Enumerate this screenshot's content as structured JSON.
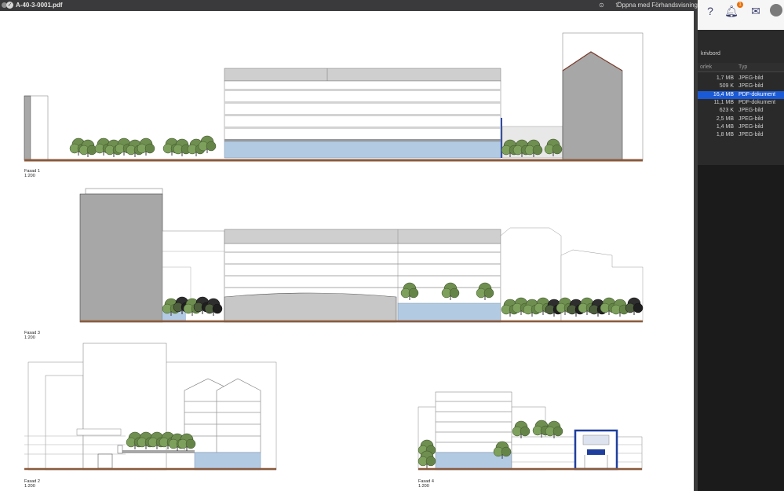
{
  "window": {
    "filename": "A-40-3-0001.pdf",
    "open_with": "Öppna med Förhandsvisning"
  },
  "notifications": {
    "badge_count": "1"
  },
  "finder": {
    "location": "krivbord",
    "col_size": "orlek",
    "col_type": "Typ",
    "rows": [
      {
        "size": "1,7 MB",
        "type": "JPEG-bild",
        "selected": false
      },
      {
        "size": "509 K",
        "type": "JPEG-bild",
        "selected": false
      },
      {
        "size": "16,4 MB",
        "type": "PDF-dokument",
        "selected": true
      },
      {
        "size": "11,1 MB",
        "type": "PDF-dokument",
        "selected": false
      },
      {
        "size": "623 K",
        "type": "JPEG-bild",
        "selected": false
      },
      {
        "size": "2,5 MB",
        "type": "JPEG-bild",
        "selected": false
      },
      {
        "size": "1,4 MB",
        "type": "JPEG-bild",
        "selected": false
      },
      {
        "size": "1,8 MB",
        "type": "JPEG-bild",
        "selected": false
      }
    ]
  },
  "drawings": [
    {
      "name": "Fasad 1",
      "scale": "1:200"
    },
    {
      "name": "Fasad 3",
      "scale": "1:200"
    },
    {
      "name": "Fasad 2",
      "scale": "1:200"
    },
    {
      "name": "Fasad 4",
      "scale": "1:200"
    }
  ],
  "colors": {
    "glass": "#b3cae3",
    "ground": "#8a5a3c",
    "wall_gray": "#a7a7a7",
    "selection": "#1a5ad7"
  }
}
